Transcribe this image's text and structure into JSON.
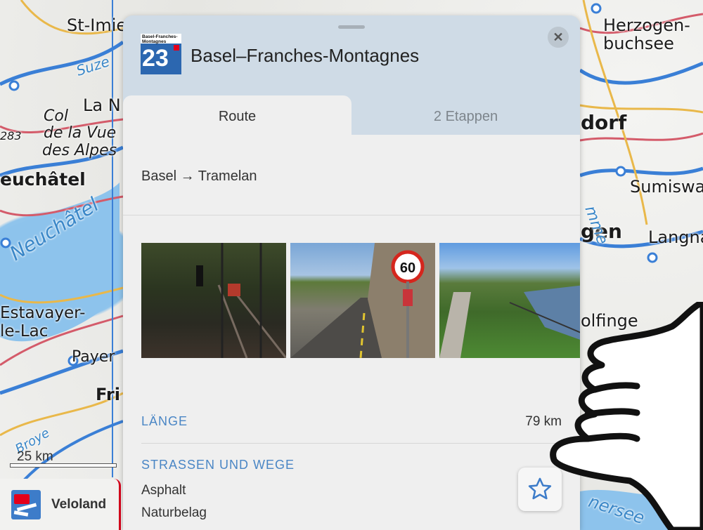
{
  "map": {
    "labels": [
      {
        "id": "st-imier",
        "text": "St-Imie"
      },
      {
        "id": "suze",
        "text": "Suze"
      },
      {
        "id": "la-n",
        "text": "La N"
      },
      {
        "id": "col1",
        "text": "Col"
      },
      {
        "id": "col2",
        "text": "de la Vue"
      },
      {
        "id": "col3",
        "text": "des Alpes"
      },
      {
        "id": "alt",
        "text": "283"
      },
      {
        "id": "neuchatel",
        "text": "euchâtel"
      },
      {
        "id": "lac",
        "text": "Neuchâtel"
      },
      {
        "id": "estavayer1",
        "text": "Estavayer-"
      },
      {
        "id": "estavayer2",
        "text": "le-Lac"
      },
      {
        "id": "payerne",
        "text": "Payer"
      },
      {
        "id": "fri",
        "text": "Fri"
      },
      {
        "id": "broye",
        "text": "Broye"
      },
      {
        "id": "herzogen1",
        "text": "Herzogen-"
      },
      {
        "id": "herzogen2",
        "text": "buchsee"
      },
      {
        "id": "dorf",
        "text": "dorf"
      },
      {
        "id": "sumiswa",
        "text": "Sumiswa"
      },
      {
        "id": "gen",
        "text": "gen"
      },
      {
        "id": "langna",
        "text": "Langna"
      },
      {
        "id": "emme",
        "text": "mme"
      },
      {
        "id": "olfinge",
        "text": "olfinge"
      },
      {
        "id": "thunersee",
        "text": "nersee"
      }
    ],
    "scale": "25 km"
  },
  "veloland": {
    "label": "Veloland"
  },
  "panel": {
    "close_icon": "close-icon",
    "route_number": "23",
    "route_logo_text": "Basel-Franches-Montagnes",
    "title": "Basel–Franches-Montagnes",
    "tabs": [
      {
        "label": "Route"
      },
      {
        "label": "2 Etappen"
      }
    ],
    "route": "Basel → Tramelan",
    "photos": [
      "railway-photo",
      "road-speed-sign-photo",
      "river-path-photo"
    ],
    "speed_sign": "60",
    "length": {
      "label": "LÄNGE",
      "value": "79 km"
    },
    "surfaces": {
      "label": "STRASSEN UND WEGE",
      "items": [
        "Asphalt",
        "Naturbelag"
      ]
    },
    "favorite_icon": "star-icon"
  },
  "colors": {
    "accent": "#4a86c5",
    "panel_header": "#cfdbe6",
    "route_red": "#d6001c"
  }
}
